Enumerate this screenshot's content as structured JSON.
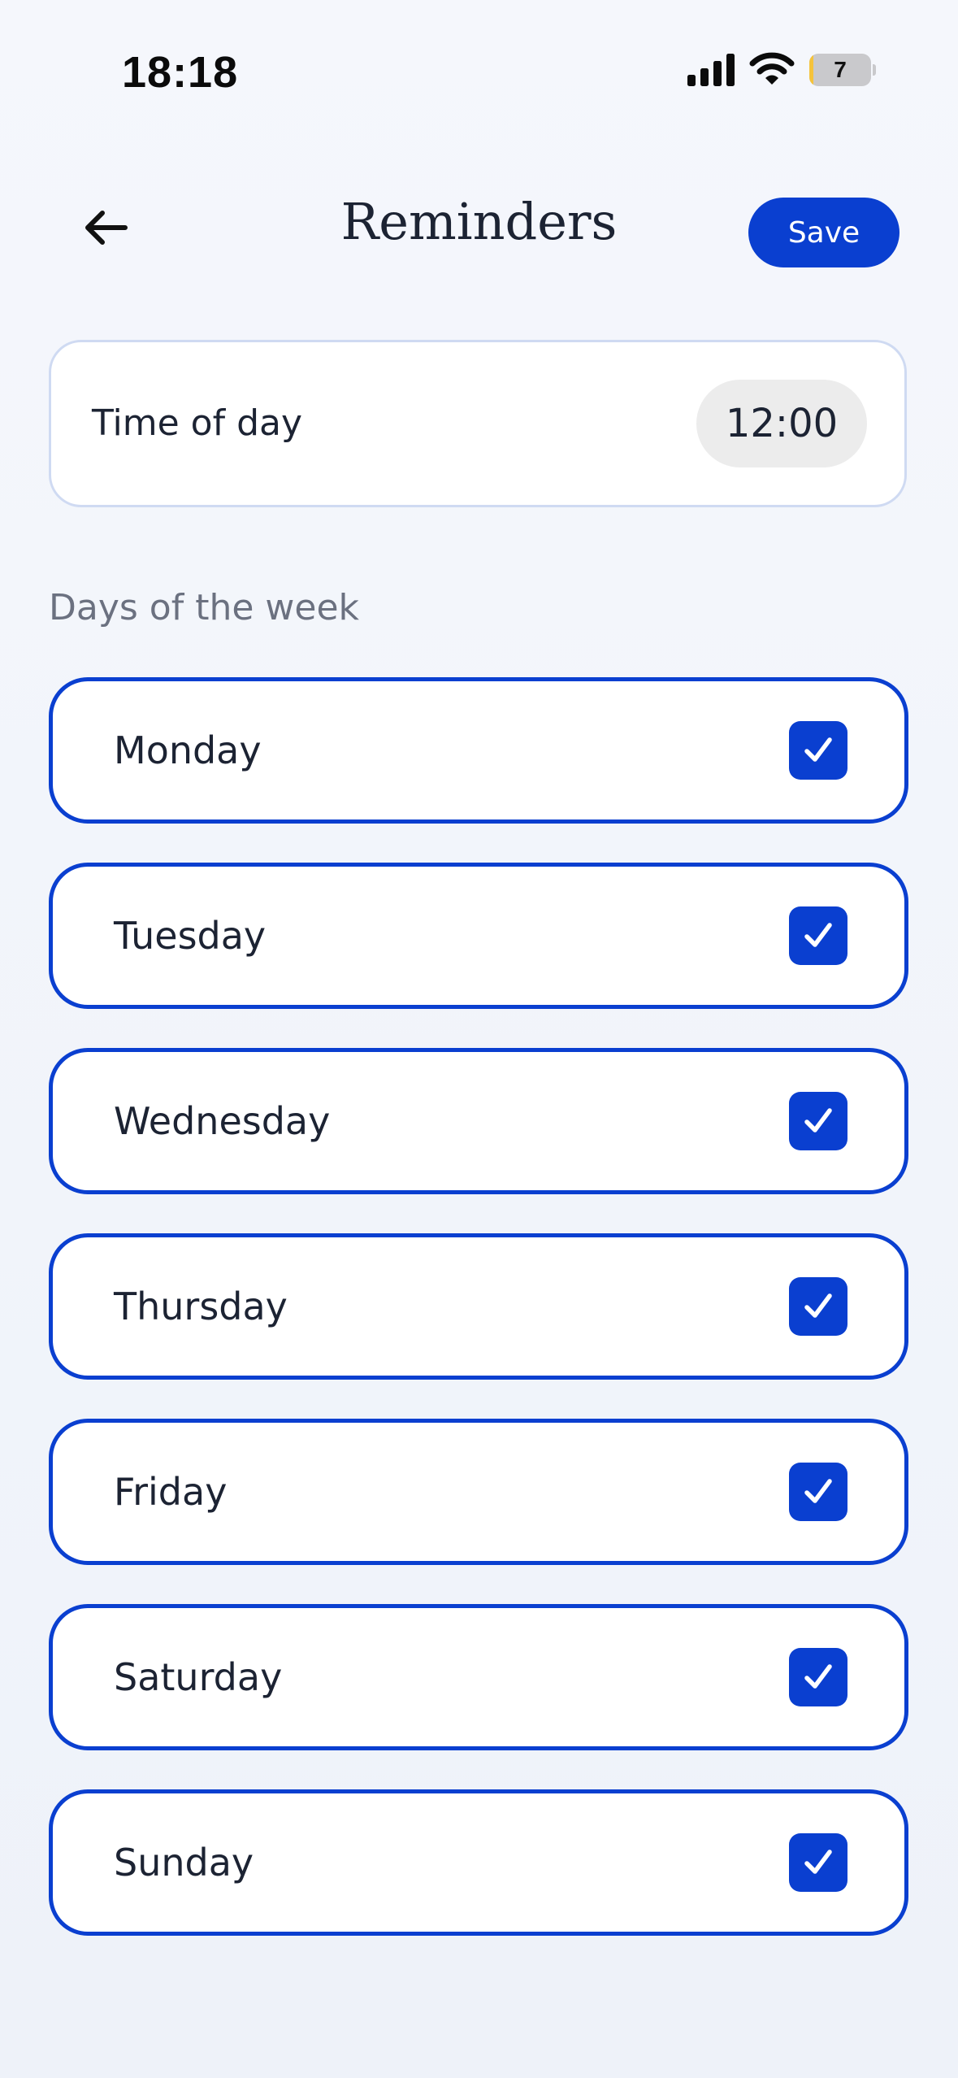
{
  "status_bar": {
    "time": "18:18",
    "battery_level": "7",
    "battery_fraction": 0.07
  },
  "header": {
    "title": "Reminders",
    "save_label": "Save",
    "back_icon": "arrow-left-icon"
  },
  "time_setting": {
    "label": "Time of day",
    "value": "12:00"
  },
  "days_section": {
    "heading": "Days of the week",
    "days": [
      {
        "label": "Monday",
        "checked": true
      },
      {
        "label": "Tuesday",
        "checked": true
      },
      {
        "label": "Wednesday",
        "checked": true
      },
      {
        "label": "Thursday",
        "checked": true
      },
      {
        "label": "Friday",
        "checked": true
      },
      {
        "label": "Saturday",
        "checked": true
      },
      {
        "label": "Sunday",
        "checked": true
      }
    ]
  },
  "colors": {
    "accent": "#0a3fd0",
    "background": "#f0f3f9",
    "text": "#1c2333",
    "muted_text": "#6b7180",
    "time_pill": "#ececec",
    "battery_low": "#f5c33b"
  }
}
